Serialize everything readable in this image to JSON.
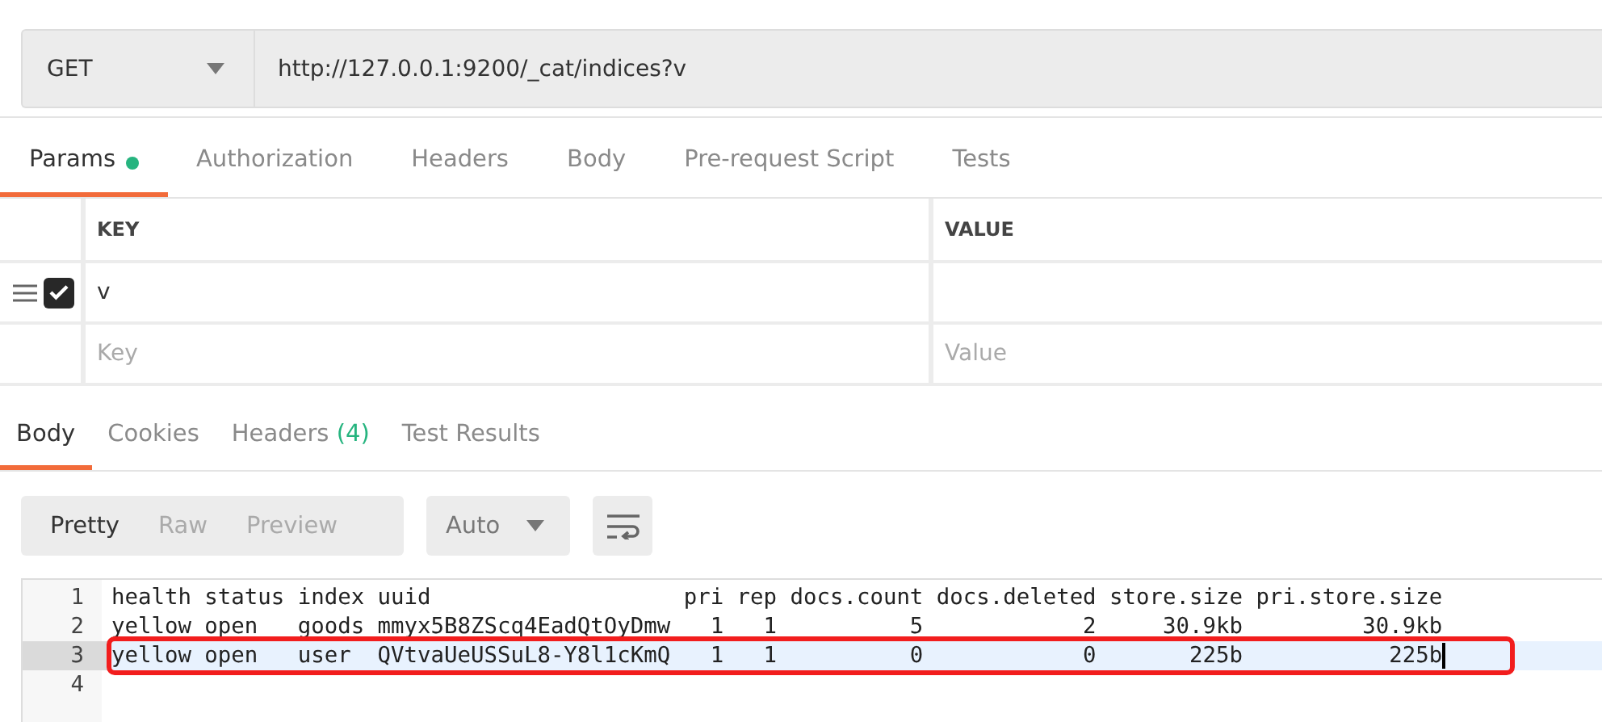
{
  "request": {
    "method": "GET",
    "url": "http://127.0.0.1:9200/_cat/indices?v"
  },
  "request_tabs": [
    {
      "label": "Params",
      "selected": true,
      "dot": true
    },
    {
      "label": "Authorization",
      "selected": false,
      "dot": false
    },
    {
      "label": "Headers",
      "selected": false,
      "dot": false
    },
    {
      "label": "Body",
      "selected": false,
      "dot": false
    },
    {
      "label": "Pre-request Script",
      "selected": false,
      "dot": false
    },
    {
      "label": "Tests",
      "selected": false,
      "dot": false
    }
  ],
  "params": {
    "columns": [
      "KEY",
      "VALUE"
    ],
    "rows": [
      {
        "checked": true,
        "key": "v"
      }
    ],
    "new_row": {
      "key_placeholder": "Key",
      "value_placeholder": "Value"
    }
  },
  "response_tabs": [
    {
      "label": "Body",
      "selected": true
    },
    {
      "label": "Cookies",
      "selected": false
    },
    {
      "label": "Headers",
      "count": "(4)",
      "selected": false
    },
    {
      "label": "Test Results",
      "selected": false
    }
  ],
  "view_modes": [
    {
      "label": "Pretty",
      "selected": true
    },
    {
      "label": "Raw",
      "selected": false
    },
    {
      "label": "Preview",
      "selected": false
    }
  ],
  "format": "Auto",
  "code_lines": [
    {
      "number": "1",
      "text": "health status index uuid                   pri rep docs.count docs.deleted store.size pri.store.size",
      "current": false,
      "highlighted": false
    },
    {
      "number": "2",
      "text": "yellow open   goods mmyx5B8ZScq4EadQtOyDmw   1   1          5            2     30.9kb         30.9kb",
      "current": false,
      "highlighted": false
    },
    {
      "number": "3",
      "text": "yellow open   user  QVtvaUeUSSuL8-Y8l1cKmQ   1   1          0            0       225b           225b",
      "current": true,
      "highlighted": true
    },
    {
      "number": "4",
      "current": false,
      "highlighted": false
    }
  ]
}
